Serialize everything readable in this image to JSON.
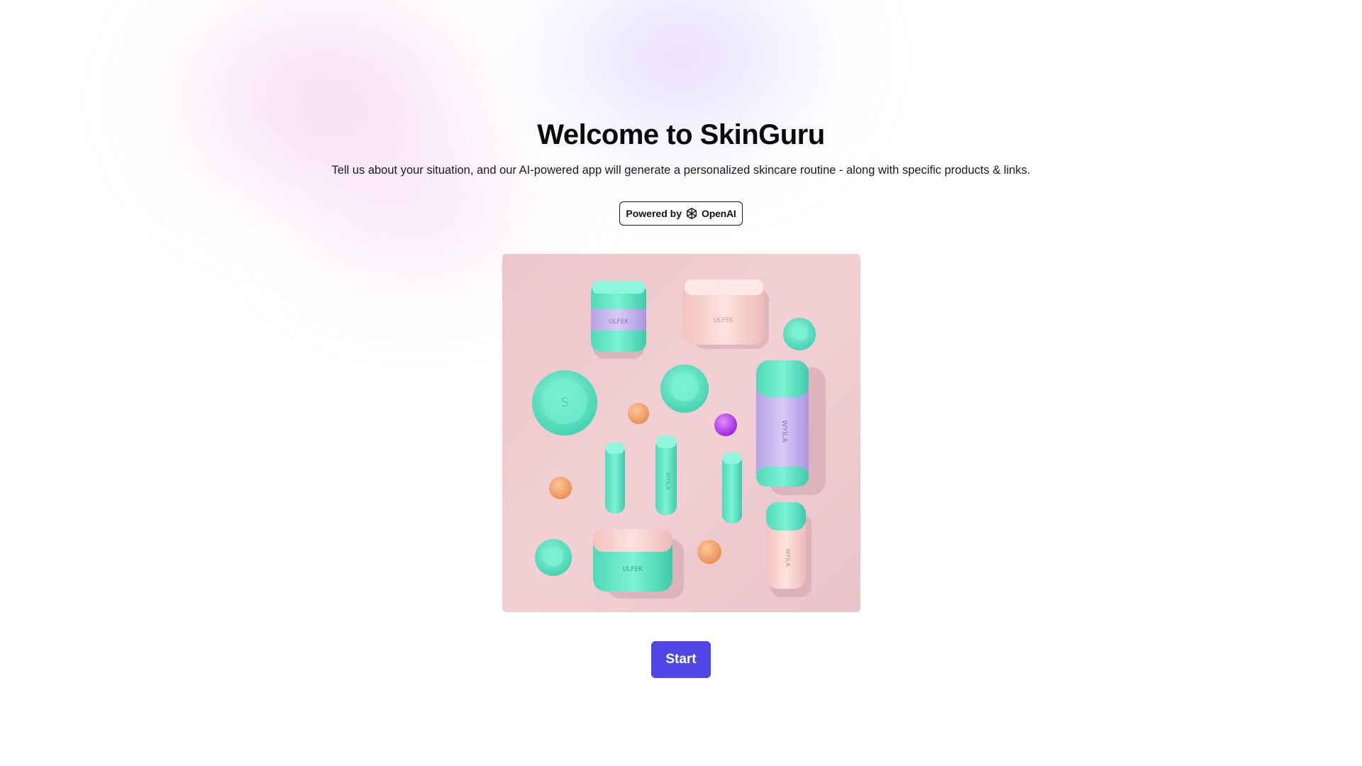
{
  "header": {
    "title": "Welcome to SkinGuru",
    "subtitle": "Tell us about your situation, and our AI-powered app will generate a personalized skincare routine - along with specific products & links."
  },
  "badge": {
    "prefix": "Powered by",
    "brand": "OpenAI",
    "icon": "openai-logo-icon"
  },
  "hero_image": {
    "description_icon": "skincare-products-illustration"
  },
  "actions": {
    "start_label": "Start"
  },
  "colors": {
    "accent": "#4f46e5",
    "image_background": "#f0c8cc",
    "product_teal": "#58e6c6",
    "product_pink": "#f8d2d0",
    "product_lavender": "#c8b6ee"
  }
}
